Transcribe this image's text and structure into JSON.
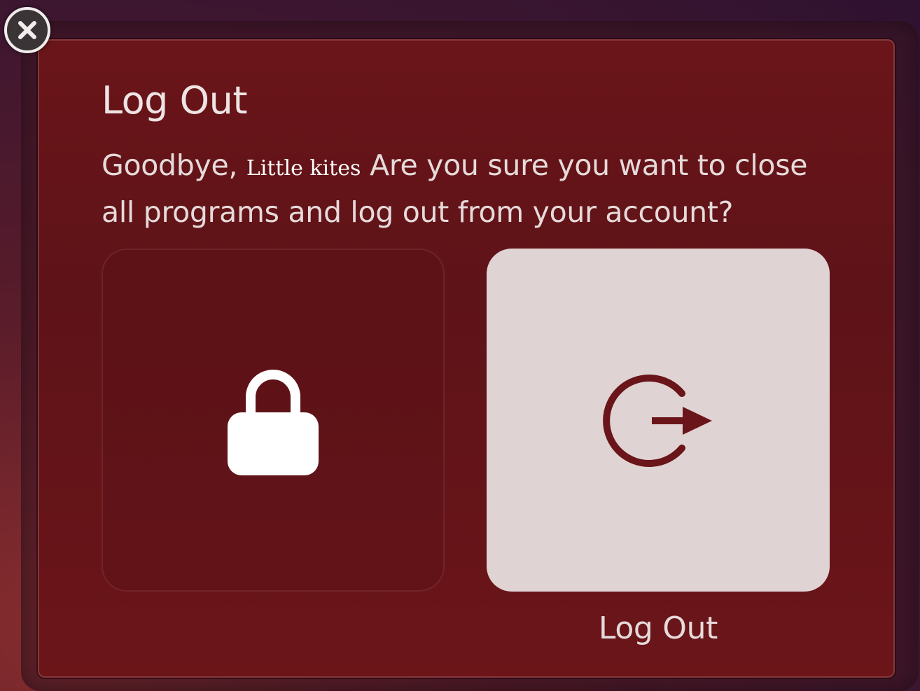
{
  "dialog": {
    "title": "Log Out",
    "message_before_name": "Goodbye, ",
    "user_name": "Little kites",
    "message_after_name": "  Are you sure you want to close all programs and log out from your account?"
  },
  "options": {
    "lock": {
      "icon": "lock-icon",
      "label": ""
    },
    "logout": {
      "icon": "logout-icon",
      "label": "Log Out"
    }
  },
  "close_button": {
    "icon": "close-icon"
  },
  "colors": {
    "dialog_bg": "#5e1318",
    "accent_icon": "#6a1519",
    "selected_tile": "#e0d3d4",
    "text": "#e6dada"
  }
}
